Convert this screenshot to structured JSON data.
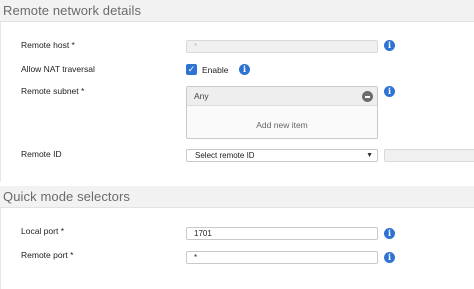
{
  "remote_network": {
    "title": "Remote network details",
    "remote_host_label": "Remote host *",
    "remote_host_value": "*",
    "allow_nat_label": "Allow NAT traversal",
    "enable_label": "Enable",
    "enable_checked": true,
    "remote_subnet_label": "Remote subnet *",
    "remote_subnet_items": [
      "Any"
    ],
    "add_new_item": "Add new item",
    "remote_id_label": "Remote ID",
    "remote_id_value": "Select remote ID"
  },
  "quick_mode": {
    "title": "Quick mode selectors",
    "local_port_label": "Local port *",
    "local_port_value": "1701",
    "remote_port_label": "Remote port *",
    "remote_port_value": "*"
  },
  "icons": {
    "info": "info-icon",
    "checkbox": "checkmark-icon",
    "remove": "minus-circle-icon",
    "dropdown": "chevron-down-icon"
  },
  "colors": {
    "accent": "#2e73d2",
    "header_bg": "#f2f2f2",
    "header_text": "#6b6b6b"
  }
}
